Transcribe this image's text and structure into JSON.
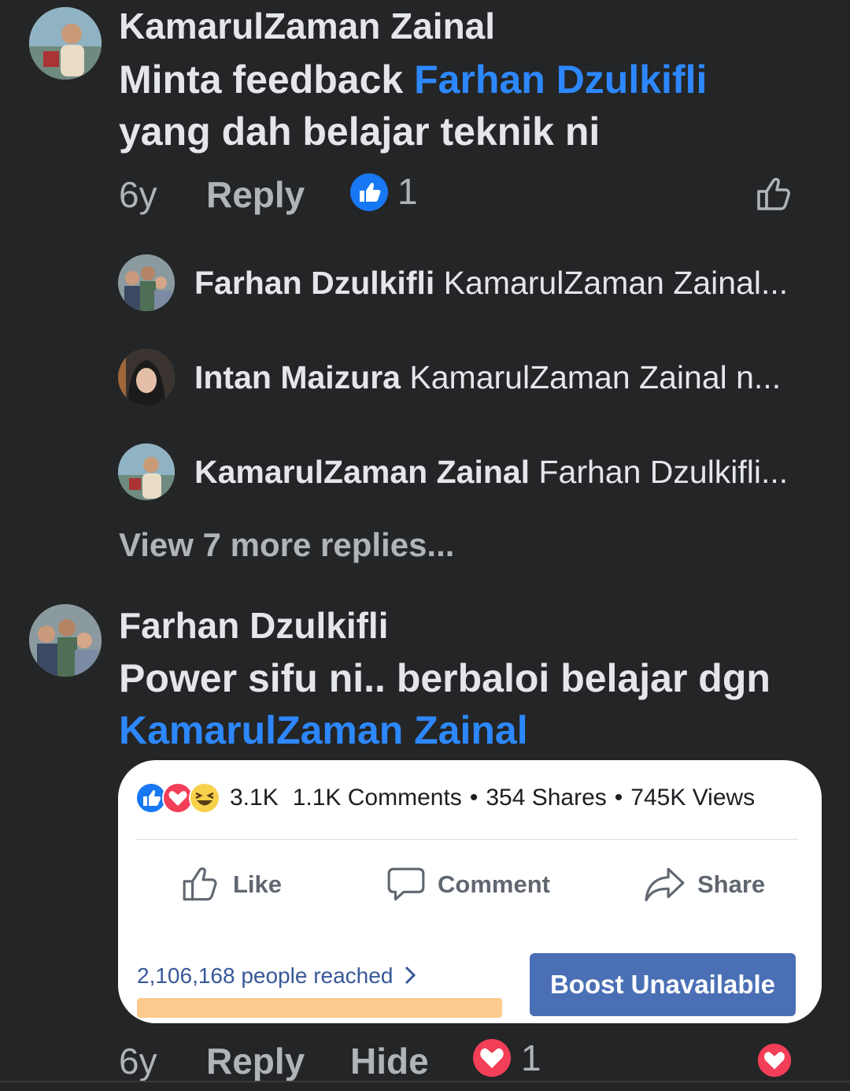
{
  "comment1": {
    "author": "KamarulZaman Zainal",
    "text_line1_prefix": "Minta feedback ",
    "text_line1_mention": "Farhan Dzulkifli",
    "text_line2": "yang dah belajar teknik ni",
    "time": "6y",
    "reply_label": "Reply",
    "reaction_count": "1",
    "like_icon": "thumbs-up-outline-icon"
  },
  "replies": [
    {
      "author": "Farhan Dzulkifli",
      "preview": "KamarulZaman Zainal..."
    },
    {
      "author": "Intan Maizura",
      "preview": "KamarulZaman Zainal n..."
    },
    {
      "author": "KamarulZaman Zainal",
      "preview": "Farhan Dzulkifli..."
    }
  ],
  "view_more": "View 7 more replies...",
  "comment2": {
    "author": "Farhan Dzulkifli",
    "text_line1": "Power sifu ni.. berbaloi belajar dgn",
    "text_mention": "KamarulZaman Zainal",
    "time": "6y",
    "reply_label": "Reply",
    "hide_label": "Hide",
    "reaction_count": "1"
  },
  "card": {
    "reactions_count": "3.1K",
    "comments": "1.1K Comments",
    "shares": "354 Shares",
    "views": "745K Views",
    "separator": "•",
    "like_label": "Like",
    "comment_label": "Comment",
    "share_label": "Share",
    "reached": "2,106,168 people reached",
    "boost_label": "Boost Unavailable",
    "reach_progress": 1.0
  },
  "colors": {
    "background": "#242526",
    "mention": "#2d88ff",
    "like_blue": "#1877f2",
    "love_red": "#f33e58",
    "boost": "#4a6fb5"
  }
}
